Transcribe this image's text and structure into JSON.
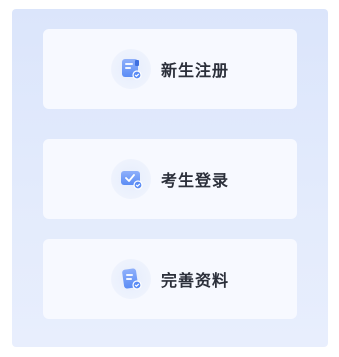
{
  "menu": {
    "items": [
      {
        "label": "新生注册",
        "icon": "register-form-icon"
      },
      {
        "label": "考生登录",
        "icon": "login-check-icon"
      },
      {
        "label": "完善资料",
        "icon": "profile-doc-icon"
      }
    ]
  },
  "colors": {
    "panel_bg": "#dde6fb",
    "card_bg": "#f7f9ff",
    "icon_primary": "#5b8cf5",
    "icon_light": "#a9c1fb",
    "text": "#2b2f3a"
  }
}
